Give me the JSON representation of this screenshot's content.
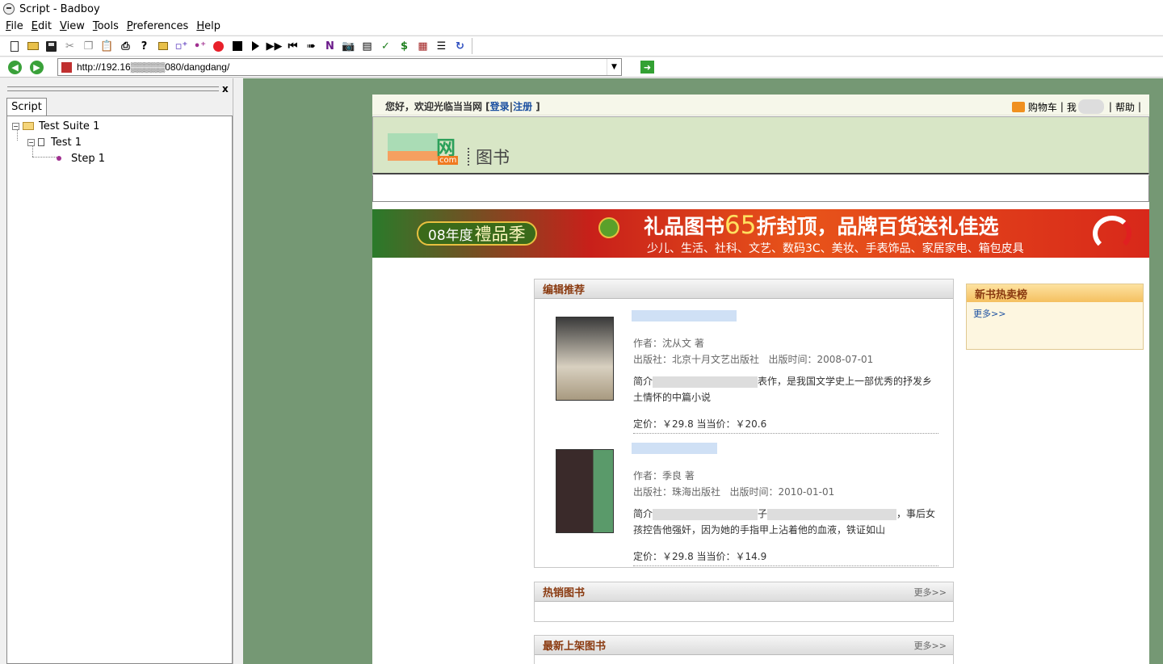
{
  "window": {
    "title": "Script - Badboy"
  },
  "menu": [
    {
      "label": "File",
      "ul": "F",
      "rest": "ile"
    },
    {
      "label": "Edit",
      "ul": "E",
      "rest": "dit"
    },
    {
      "label": "View",
      "ul": "V",
      "rest": "iew"
    },
    {
      "label": "Tools",
      "ul": "T",
      "rest": "ools"
    },
    {
      "label": "Preferences",
      "ul": "P",
      "rest": "references"
    },
    {
      "label": "Help",
      "ul": "H",
      "rest": "elp"
    }
  ],
  "toolbar_icons": [
    "new-document-icon",
    "open-folder-icon",
    "save-icon",
    "cut-icon",
    "copy-icon",
    "paste-icon",
    "print-icon",
    "help-icon",
    "add-suite-icon",
    "add-test-icon",
    "add-step-icon",
    "record-icon",
    "stop-icon",
    "play-icon",
    "play-all-icon",
    "rewind-icon",
    "step-forward-icon",
    "navigate-n-icon",
    "camera-icon",
    "report-icon",
    "check-icon",
    "variable-icon",
    "table-icon",
    "align-icon",
    "refresh-icon"
  ],
  "address": {
    "url": "http://192.16▒▒▒▒▒080/dangdang/"
  },
  "left_pane": {
    "tab": "Script",
    "close_glyph": "x",
    "tree": {
      "suite": "Test Suite 1",
      "test": "Test 1",
      "step": "Step 1"
    }
  },
  "site": {
    "welcome_prefix": "您好，欢迎光临当当网 [",
    "login": "登录",
    "sep": "|",
    "register": "注册",
    "welcome_suffix": " ]",
    "cart": "购物车",
    "my_prefix": "我",
    "help": "帮助",
    "logo_wang": "网",
    "logo_com": "com",
    "logo_sub": "图书",
    "banner": {
      "left_small": "08年度",
      "left_big": "禮品季",
      "title_prefix": "礼品图书",
      "title_num": "65",
      "title_suffix": "折封顶，品牌百货送礼佳选",
      "subtitle": "少儿、生活、社科、文艺、数码3C、美妆、手表饰品、家居家电、箱包皮具"
    },
    "editor_picks": {
      "title": "编辑推荐",
      "books": [
        {
          "author": "作者：沈从文 著",
          "publisher": "出版社：北京十月文艺出版社",
          "pubdate": "出版时间：2008-07-01",
          "desc_prefix": "简介",
          "desc_suffix": "表作，是我国文学史上一部优秀的抒发乡土情怀的中篇小说",
          "price": "定价：￥29.8  当当价：￥20.6"
        },
        {
          "author": "作者：季良 著",
          "publisher": "出版社：珠海出版社",
          "pubdate": "出版时间：2010-01-01",
          "desc_prefix": "简介",
          "desc_mid": "子",
          "desc_suffix": "，事后女孩控告他强奸，因为她的手指甲上沾着他的血液，铁证如山",
          "price": "定价：￥29.8  当当价：￥14.9"
        }
      ]
    },
    "hot_books": {
      "title": "热销图书",
      "more": "更多>>"
    },
    "new_books": {
      "title": "最新上架图书",
      "more": "更多>>"
    },
    "side_rank": {
      "title": "新书热卖榜",
      "more": "更多>>"
    }
  }
}
